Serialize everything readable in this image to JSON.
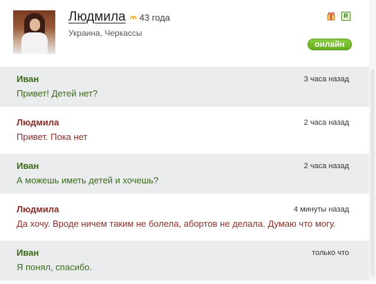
{
  "profile": {
    "name": "Людмила",
    "age": "43 года",
    "location": "Украина, Черкассы",
    "zodiac_icon": "zodiac-icon",
    "top_icons": [
      "gift-icon",
      "r-badge"
    ],
    "r_badge": "R",
    "status": "онлайн",
    "status_color": "#6ab329"
  },
  "messages": [
    {
      "author": "Иван",
      "time": "3 часа назад",
      "text": "Привет! Детей нет?"
    },
    {
      "author": "Людмила",
      "time": "2 часа назад",
      "text": "Привет. Пока нет"
    },
    {
      "author": "Иван",
      "time": "2 часа назад",
      "text": "А можешь иметь детей и хочешь?"
    },
    {
      "author": "Людмила",
      "time": "4 минуты назад",
      "text": "Да хочу. Вроде ничем таким не болела, абортов не делала. Думаю что могу."
    },
    {
      "author": "Иван",
      "time": "только что",
      "text": "Я понял, спасибо."
    }
  ],
  "colors": {
    "ivan": "#3a6a15",
    "ludmila": "#8a2d26",
    "row_alt": "#ebeced"
  }
}
